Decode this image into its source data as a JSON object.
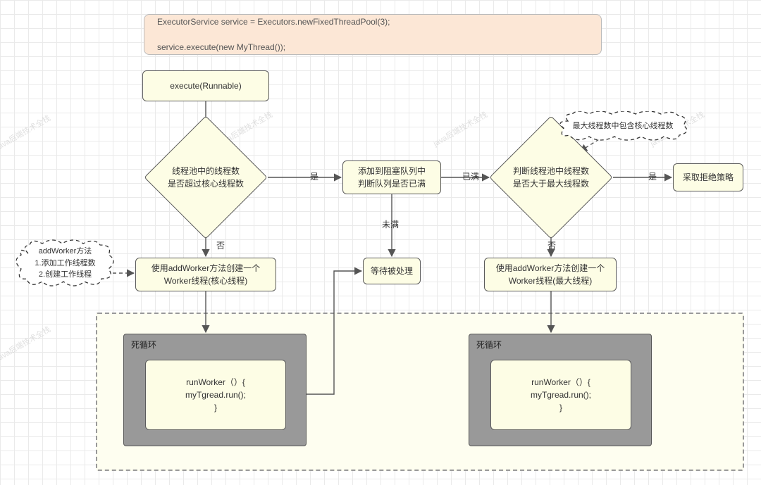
{
  "code": {
    "line1": "ExecutorService service = Executors.newFixedThreadPool(3);",
    "line2": "service.execute(new MyThread());"
  },
  "nodes": {
    "execute": "execute(Runnable)",
    "dec_core": "线程池中的线程数\n是否超过核心线程数",
    "add_worker_core": "使用addWorker方法创建一个\nWorker线程(核心线程)",
    "add_queue": "添加到阻塞队列中\n判断队列是否已满",
    "wait_process": "等待被处理",
    "dec_max": "判断线程池中线程数\n是否大于最大线程数",
    "add_worker_max": "使用addWorker方法创建一个\nWorker线程(最大线程)",
    "reject": "采取拒绝策略",
    "loop1_title": "死循环",
    "loop2_title": "死循环",
    "run_worker": "runWorker（）{\nmyTgread.run();\n}"
  },
  "labels": {
    "yes": "是",
    "no": "否",
    "full": "已满",
    "not_full": "未满"
  },
  "clouds": {
    "left": "addWorker方法\n1.添加工作线程数\n2.创建工作线程",
    "right": "最大线程数中包含核心线程数"
  },
  "watermark": "java后端技术全栈"
}
